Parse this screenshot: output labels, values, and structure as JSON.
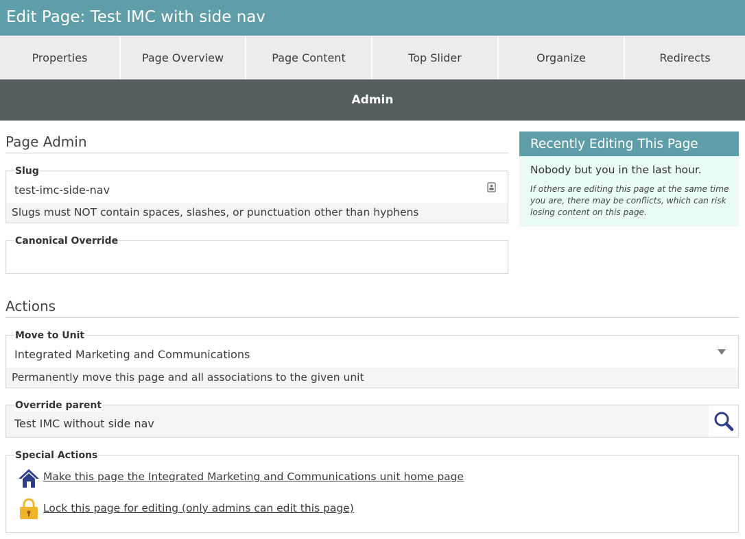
{
  "header": {
    "title": "Edit Page: Test IMC with side nav"
  },
  "tabs": [
    {
      "label": "Properties"
    },
    {
      "label": "Page Overview"
    },
    {
      "label": "Page Content"
    },
    {
      "label": "Top Slider"
    },
    {
      "label": "Organize"
    },
    {
      "label": "Redirects"
    }
  ],
  "admin_bar": {
    "label": "Admin"
  },
  "page_admin": {
    "heading": "Page Admin",
    "slug": {
      "label": "Slug",
      "value": "test-imc-side-nav",
      "help": "Slugs must NOT contain spaces, slashes, or punctuation other than hyphens"
    },
    "canonical": {
      "label": "Canonical Override",
      "value": ""
    }
  },
  "recent": {
    "heading": "Recently Editing This Page",
    "status": "Nobody but you in the last hour.",
    "note": "If others are editing this page at the same time you are, there may be conflicts, which can risk losing content on this page."
  },
  "actions": {
    "heading": "Actions",
    "move_to_unit": {
      "label": "Move to Unit",
      "value": "Integrated Marketing and Communications",
      "help": "Permanently move this page and all associations to the given unit"
    },
    "override_parent": {
      "label": "Override parent",
      "value": "Test IMC without side nav"
    },
    "special": {
      "label": "Special Actions",
      "home_link": "Make this page the Integrated Marketing and Communications unit home page",
      "lock_link": "Lock this page for editing (only admins can edit this page)"
    }
  },
  "colors": {
    "teal": "#5f9ea8",
    "admin_bar": "#545d60",
    "home_icon": "#2e3c8c",
    "lock_icon": "#f0b429",
    "recent_bg": "#e9fbf4"
  },
  "icons": {
    "slug": "id-card-icon",
    "dropdown": "chevron-down-icon",
    "search": "search-icon",
    "home": "home-icon",
    "lock": "lock-icon"
  }
}
